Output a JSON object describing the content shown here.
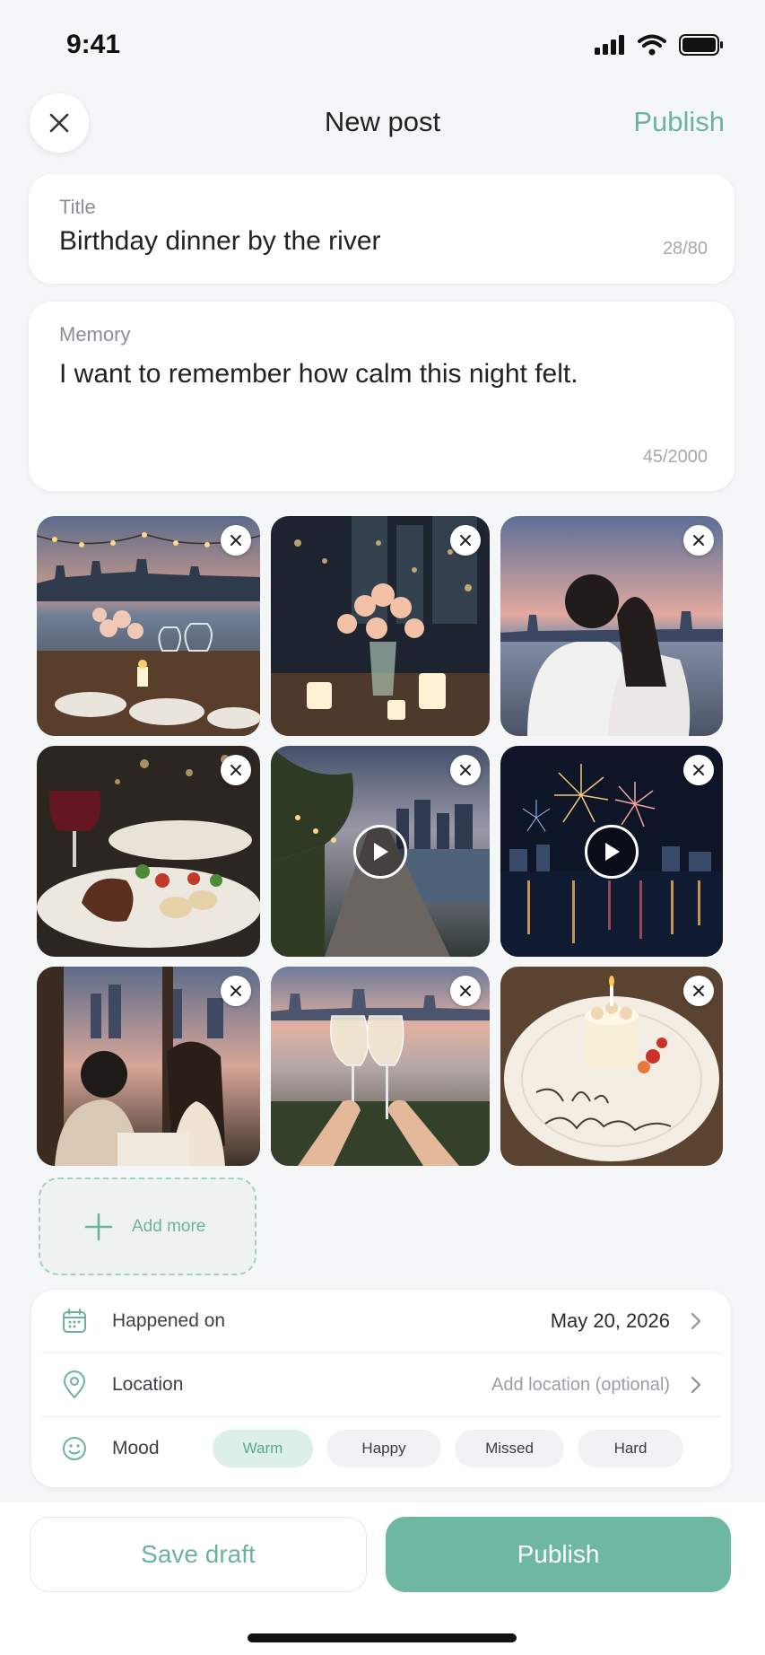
{
  "status_bar": {
    "time": "9:41"
  },
  "header": {
    "title": "New post",
    "publish_label": "Publish"
  },
  "title_field": {
    "label": "Title",
    "value": "Birthday dinner by the river",
    "counter": "28/80"
  },
  "memory_field": {
    "label": "Memory",
    "value": "I want to remember how calm this night felt.",
    "counter": "45/2000"
  },
  "media": [
    {
      "kind": "photo",
      "subject": "riverside dinner table with flowers and string lights"
    },
    {
      "kind": "photo",
      "subject": "roses and candles at night"
    },
    {
      "kind": "photo",
      "subject": "couple embracing at sunset by the river"
    },
    {
      "kind": "photo",
      "subject": "steak dinner plate with red wine"
    },
    {
      "kind": "video",
      "subject": "riverside promenade at dusk"
    },
    {
      "kind": "video",
      "subject": "fireworks over the river"
    },
    {
      "kind": "photo",
      "subject": "couple having dinner"
    },
    {
      "kind": "photo",
      "subject": "toasting wine glasses at sunset"
    },
    {
      "kind": "photo",
      "subject": "birthday cake with candle"
    }
  ],
  "add_more": {
    "label": "Add more"
  },
  "details": {
    "date": {
      "label": "Happened on",
      "value": "May 20, 2026",
      "icon": "calendar-icon"
    },
    "location": {
      "label": "Location",
      "placeholder": "Add location (optional)",
      "icon": "location-pin-icon"
    },
    "mood": {
      "label": "Mood",
      "icon": "smile-icon",
      "options": [
        "Warm",
        "Happy",
        "Missed",
        "Hard"
      ],
      "selected": "Warm"
    }
  },
  "footer": {
    "save_draft_label": "Save draft",
    "publish_label": "Publish"
  },
  "colors": {
    "accent": "#6bb39e",
    "accent_fill": "#6eb8a1",
    "chip_active_bg": "#dcefe8",
    "background": "#f5f6f7"
  }
}
